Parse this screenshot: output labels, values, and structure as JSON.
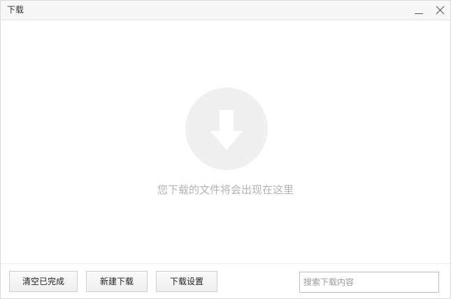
{
  "window": {
    "title": "下载"
  },
  "empty_state": {
    "message": "您下载的文件将会出现在这里",
    "icon": "download-arrow-icon"
  },
  "footer": {
    "clear_label": "清空已完成",
    "new_label": "新建下载",
    "settings_label": "下载设置",
    "search_placeholder": "搜索下载内容",
    "search_value": ""
  },
  "colors": {
    "titlebar_bg": "#f7f7f7",
    "empty_circle": "#f0f0f0",
    "empty_text": "#b3b3b3",
    "button_border": "#cfcfcf"
  }
}
